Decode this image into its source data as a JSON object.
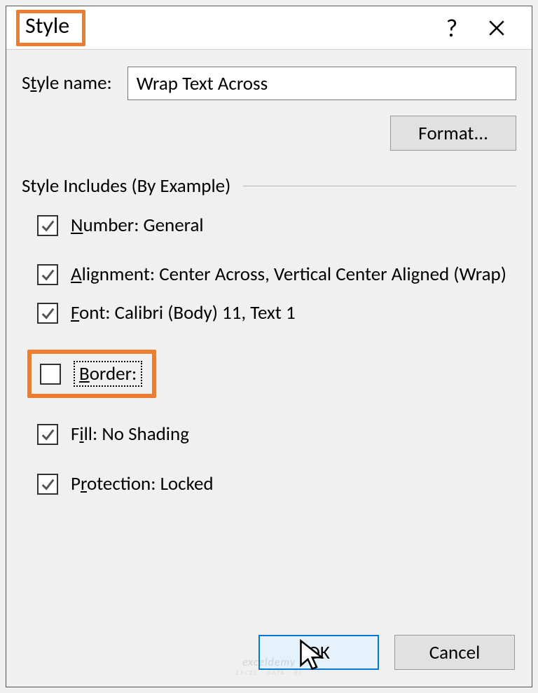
{
  "titlebar": {
    "title": "Style"
  },
  "style_name": {
    "label_pre": "S",
    "label_ul": "t",
    "label_post": "yle name:",
    "value": "Wrap Text Across"
  },
  "format_button": {
    "label_pre": "F",
    "label_ul": "o",
    "label_post": "rmat..."
  },
  "group_legend": "Style Includes (By Example)",
  "items": {
    "number": {
      "checked": true,
      "ul": "N",
      "rest": "umber: General"
    },
    "alignment": {
      "checked": true,
      "ul": "A",
      "rest": "lignment: Center Across, Vertical Center Aligned (Wrap)"
    },
    "font": {
      "checked": true,
      "ul": "F",
      "rest": "ont: Calibri (Body) 11, Text 1"
    },
    "border": {
      "checked": false,
      "ul": "B",
      "rest": "order:"
    },
    "fill": {
      "checked": true,
      "nl": "F",
      "ul": "i",
      "rest": "ll: No Shading"
    },
    "protection": {
      "checked": true,
      "nl": "P",
      "ul": "r",
      "rest": "otection: Locked"
    }
  },
  "buttons": {
    "ok": "OK",
    "cancel": "Cancel"
  },
  "watermark": {
    "main": "exceldemy",
    "sub": "EXCEL · DATA · BI"
  },
  "colors": {
    "accent": "#ed7d31",
    "ok_border": "#0178d7",
    "ok_fill": "#e5f1fb"
  }
}
